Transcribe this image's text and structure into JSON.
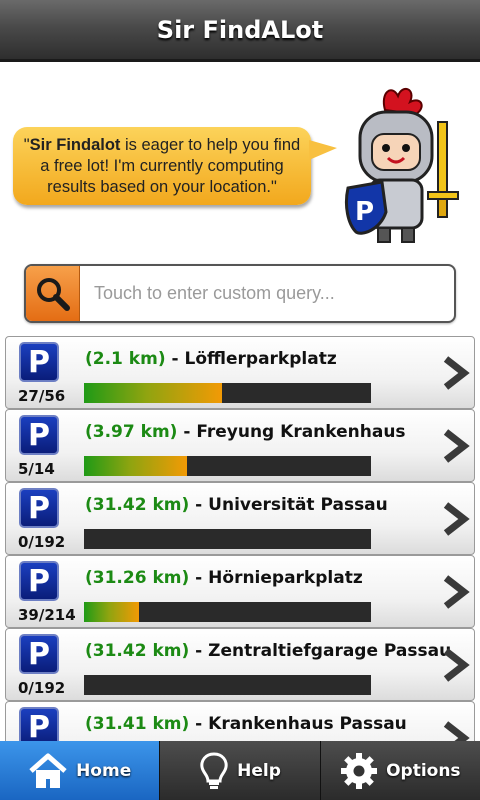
{
  "app": {
    "title": "Sir FindALot"
  },
  "bubble": {
    "bold": "Sir Findalot",
    "text": " is eager to help you find a free lot! I'm currently computing results based on your location.",
    "open_quote": "\"",
    "close_quote": "\""
  },
  "search": {
    "placeholder": "Touch to enter custom query...",
    "value": ""
  },
  "lots": [
    {
      "distance": "(2.1 km)",
      "name": "Löfflerparkplatz",
      "count": "27/56",
      "fill": 0.48
    },
    {
      "distance": "(3.97 km)",
      "name": "Freyung Krankenhaus",
      "count": "5/14",
      "fill": 0.36
    },
    {
      "distance": "(31.42 km)",
      "name": "Universität Passau",
      "count": "0/192",
      "fill": 0.0
    },
    {
      "distance": "(31.26 km)",
      "name": "Hörnieparkplatz",
      "count": "39/214",
      "fill": 0.19
    },
    {
      "distance": "(31.42 km)",
      "name": "Zentraltiefgarage Passau",
      "count": "0/192",
      "fill": 0.0
    },
    {
      "distance": "(31.41 km)",
      "name": "Krankenhaus Passau",
      "count": "",
      "fill": 0.0
    }
  ],
  "nav": {
    "home": "Home",
    "help": "Help",
    "options": "Options"
  },
  "colors": {
    "accent_blue": "#2a7fd8",
    "distance_green": "#1c8a14",
    "bubble_orange": "#f5b22c",
    "parking_blue": "#0f2a9a"
  }
}
